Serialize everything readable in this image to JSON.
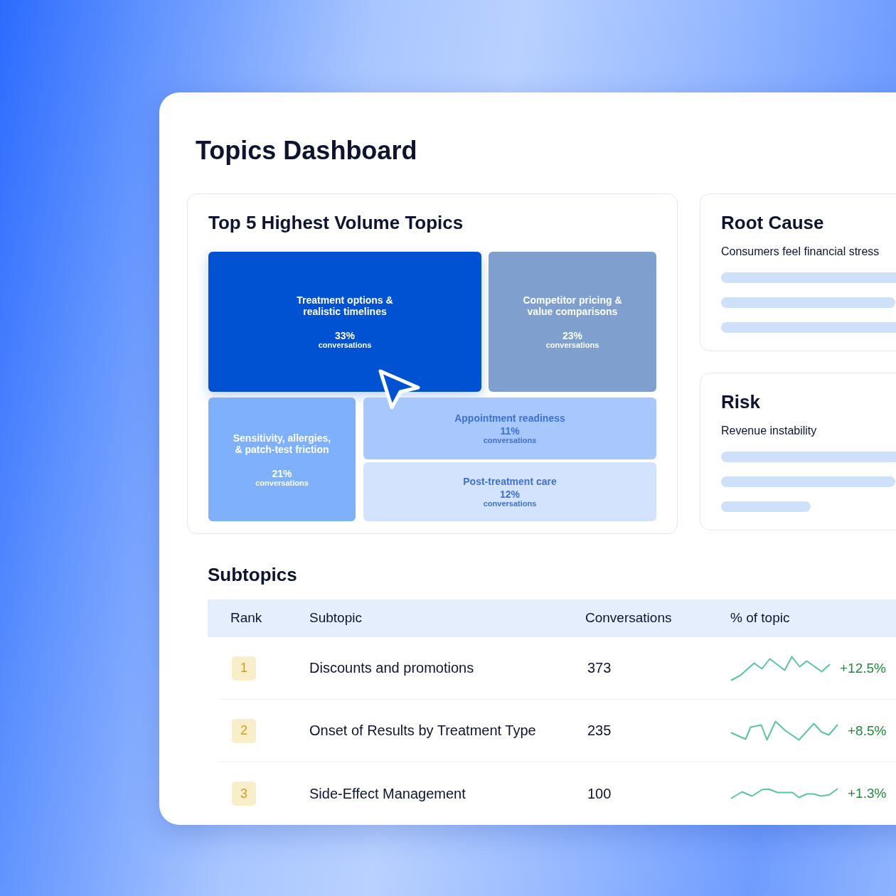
{
  "title": "Topics Dashboard",
  "top_topics": {
    "title": "Top 5 Highest Volume Topics",
    "tiles": [
      {
        "label": "Treatment options & realistic timelines",
        "percent": "33%",
        "unit": "conversations",
        "color": "#0052d3"
      },
      {
        "label": "Competitor pricing & value comparisons",
        "percent": "23%",
        "unit": "conversations",
        "color": "#7f9fcf"
      },
      {
        "label": "Sensitivity, allergies, & patch-test friction",
        "percent": "21%",
        "unit": "conversations",
        "color": "#7fb0fb"
      },
      {
        "label": "Appointment readiness",
        "percent": "11%",
        "unit": "conversations",
        "color": "#a7c7fd"
      },
      {
        "label": "Post-treatment care",
        "percent": "12%",
        "unit": "conversations",
        "color": "#d3e3fd"
      }
    ]
  },
  "insight_cards": [
    {
      "title": "Root Cause",
      "summary": "Consumers feel financial stress"
    },
    {
      "title": "Risk",
      "summary": "Revenue instability"
    }
  ],
  "subtopics": {
    "title": "Subtopics",
    "columns": [
      "Rank",
      "Subtopic",
      "Conversations",
      "% of topic"
    ],
    "rows": [
      {
        "rank": "1",
        "subtopic": "Discounts and promotions",
        "conversations": "373",
        "change": "+12.5%"
      },
      {
        "rank": "2",
        "subtopic": "Onset of Results by Treatment Type",
        "conversations": "235",
        "change": "+8.5%"
      },
      {
        "rank": "3",
        "subtopic": "Side-Effect Management",
        "conversations": "100",
        "change": "+1.3%"
      }
    ]
  }
}
